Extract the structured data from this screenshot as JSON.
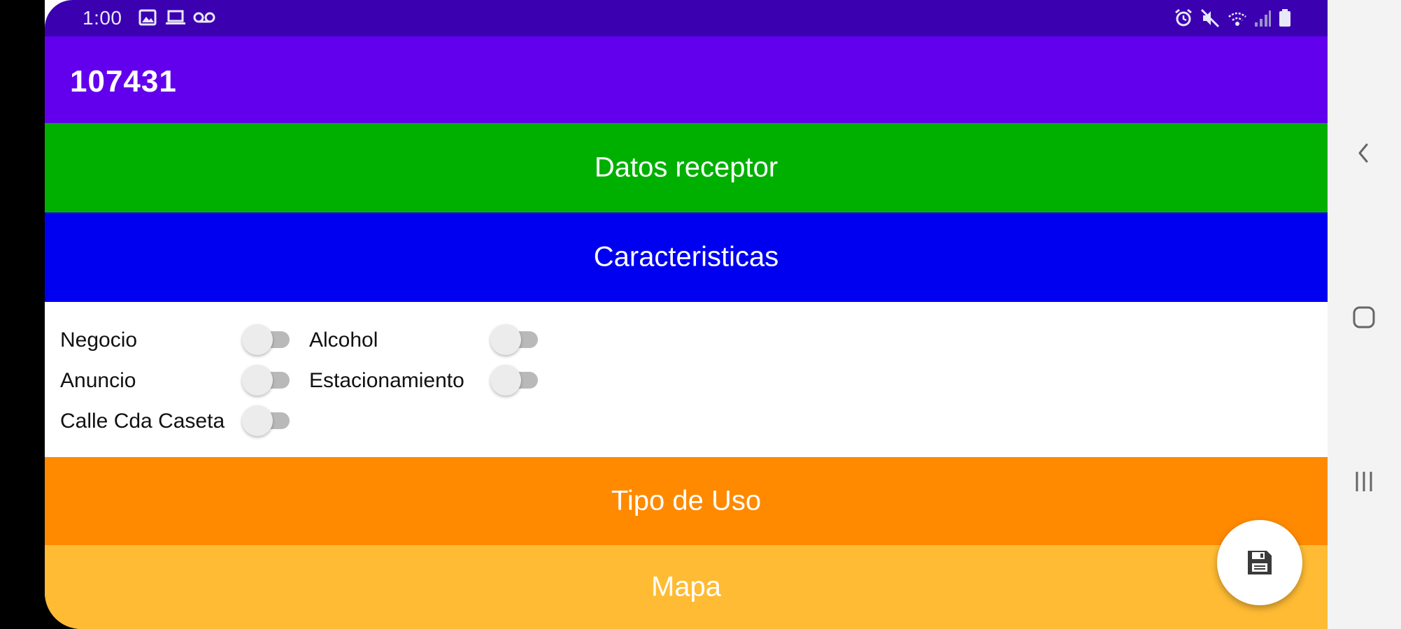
{
  "status_bar": {
    "time": "1:00",
    "left_icons": [
      "image-icon",
      "laptop-icon",
      "voicemail-icon"
    ],
    "right_icons": [
      "alarm-icon",
      "mute-icon",
      "wifi-calling-icon",
      "signal-icon",
      "battery-icon"
    ]
  },
  "app_bar": {
    "title": "107431"
  },
  "sections": {
    "datos_receptor": "Datos receptor",
    "caracteristicas": "Caracteristicas",
    "tipo_de_uso": "Tipo de Uso",
    "mapa": "Mapa"
  },
  "caracteristicas_toggles": [
    {
      "label": "Negocio",
      "checked": false
    },
    {
      "label": "Alcohol",
      "checked": false
    },
    {
      "label": "Anuncio",
      "checked": false
    },
    {
      "label": "Estacionamiento",
      "checked": false
    },
    {
      "label": "Calle Cda Caseta",
      "checked": false
    }
  ],
  "fab": {
    "icon": "save-icon"
  },
  "nav_bar": {
    "buttons": [
      "back-icon",
      "home-icon",
      "recent-apps-icon"
    ]
  },
  "colors": {
    "status_bar": "#3b00b0",
    "app_bar": "#6200ee",
    "datos_receptor": "#00b000",
    "caracteristicas": "#0000f0",
    "tipo_de_uso": "#ff8a00",
    "mapa": "#ffbb33"
  }
}
